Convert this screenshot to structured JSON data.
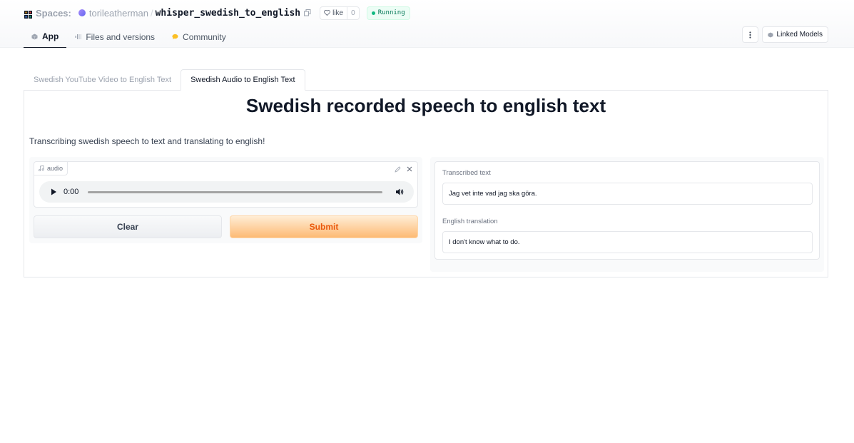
{
  "header": {
    "spaces_label": "Spaces:",
    "owner": "torileatherman",
    "repo": "whisper_swedish_to_english",
    "like_label": "like",
    "like_count": "0",
    "status": "Running",
    "status_color": "#10b981"
  },
  "nav": {
    "tabs": [
      {
        "label": "App",
        "icon": "app-cube-icon",
        "active": true
      },
      {
        "label": "Files and versions",
        "icon": "files-icon",
        "active": false
      },
      {
        "label": "Community",
        "icon": "community-icon",
        "active": false
      }
    ],
    "linked_models_label": "Linked Models"
  },
  "app": {
    "tabs": [
      {
        "label": "Swedish YouTube Video to English Text",
        "selected": false
      },
      {
        "label": "Swedish Audio to English Text",
        "selected": true
      }
    ],
    "title": "Swedish recorded speech to english text",
    "description": "Transcribing swedish speech to text and translating to english!",
    "audio": {
      "label": "audio",
      "time": "0:00"
    },
    "buttons": {
      "clear": "Clear",
      "submit": "Submit"
    },
    "outputs": {
      "transcribed_label": "Transcribed text",
      "transcribed_value": "Jag vet inte vad jag ska göra.",
      "translation_label": "English translation",
      "translation_value": "I don't know what to do."
    },
    "accent_color": "#ea580c"
  }
}
